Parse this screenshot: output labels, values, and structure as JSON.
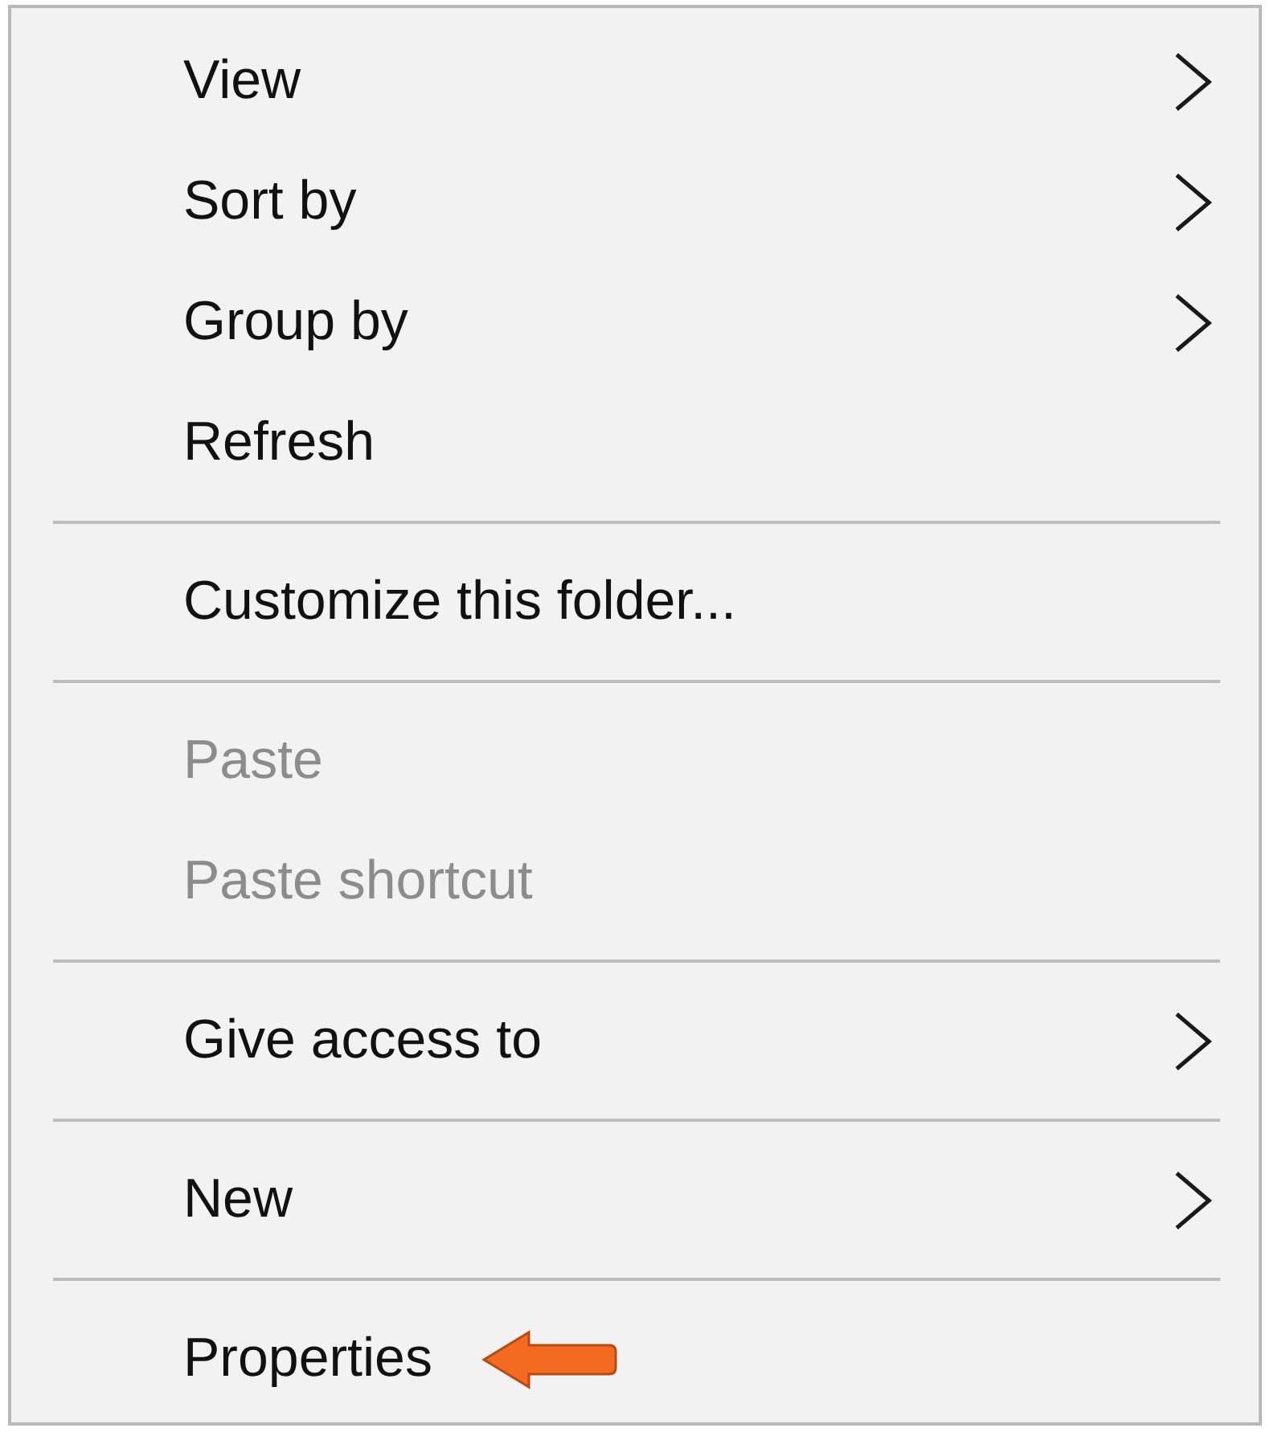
{
  "menu": {
    "items": [
      {
        "kind": "item",
        "label": "View",
        "submenu": true,
        "disabled": false,
        "pointer_arrow": false
      },
      {
        "kind": "item",
        "label": "Sort by",
        "submenu": true,
        "disabled": false,
        "pointer_arrow": false
      },
      {
        "kind": "item",
        "label": "Group by",
        "submenu": true,
        "disabled": false,
        "pointer_arrow": false
      },
      {
        "kind": "item",
        "label": "Refresh",
        "submenu": false,
        "disabled": false,
        "pointer_arrow": false
      },
      {
        "kind": "separator"
      },
      {
        "kind": "item",
        "label": "Customize this folder...",
        "submenu": false,
        "disabled": false,
        "pointer_arrow": false
      },
      {
        "kind": "separator"
      },
      {
        "kind": "item",
        "label": "Paste",
        "submenu": false,
        "disabled": true,
        "pointer_arrow": false
      },
      {
        "kind": "item",
        "label": "Paste shortcut",
        "submenu": false,
        "disabled": true,
        "pointer_arrow": false
      },
      {
        "kind": "separator"
      },
      {
        "kind": "item",
        "label": "Give access to",
        "submenu": true,
        "disabled": false,
        "pointer_arrow": false
      },
      {
        "kind": "separator"
      },
      {
        "kind": "item",
        "label": "New",
        "submenu": true,
        "disabled": false,
        "pointer_arrow": false
      },
      {
        "kind": "separator"
      },
      {
        "kind": "item",
        "label": "Properties",
        "submenu": false,
        "disabled": false,
        "pointer_arrow": true
      }
    ]
  }
}
